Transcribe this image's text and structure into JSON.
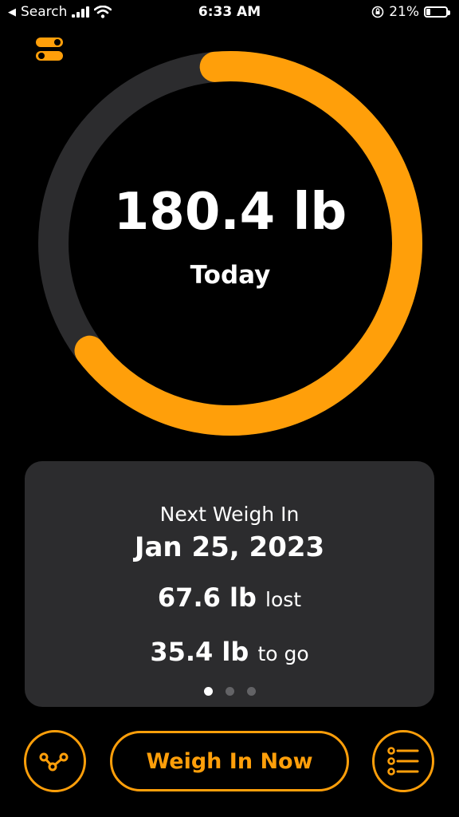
{
  "status_bar": {
    "back_label": "Search",
    "time": "6:33 AM",
    "battery_percent": "21%",
    "icons": [
      "back-arrow-icon",
      "cellular-signal-icon",
      "wifi-icon",
      "orientation-lock-icon",
      "battery-icon"
    ]
  },
  "header": {
    "settings_icon": "toggles-icon"
  },
  "progress_ring": {
    "value": "180.4 lb",
    "caption": "Today",
    "progress_fraction": 0.66,
    "accent_color": "#ff9f0a",
    "track_color": "#2c2c2e"
  },
  "summary_card": {
    "label": "Next Weigh In",
    "date": "Jan 25, 2023",
    "lost_value": "67.6 lb",
    "lost_word": "lost",
    "to_go_value": "35.4 lb",
    "to_go_word": "to go",
    "page_count": 3,
    "active_page": 1
  },
  "footer": {
    "chart_button_icon": "chart-icon",
    "primary_button_label": "Weigh In Now",
    "list_button_icon": "list-icon"
  }
}
